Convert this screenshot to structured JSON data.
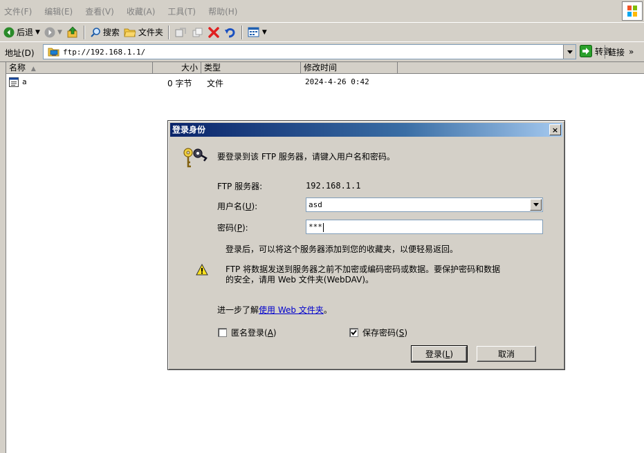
{
  "menu": {
    "items": [
      "文件(F)",
      "编辑(E)",
      "查看(V)",
      "收藏(A)",
      "工具(T)",
      "帮助(H)"
    ]
  },
  "toolbar": {
    "back_label": "后退",
    "search_label": "搜索",
    "folders_label": "文件夹"
  },
  "address": {
    "label": "地址(D)",
    "value": "ftp://192.168.1.1/",
    "go_label": "转到",
    "links_label": "链接",
    "links_chevron": "»"
  },
  "list": {
    "columns": {
      "name": "名称",
      "size": "大小",
      "type": "类型",
      "modified": "修改时间"
    },
    "rows": [
      {
        "name": "a",
        "size": "0 字节",
        "type": "文件",
        "modified": "2024-4-26 0:42"
      }
    ]
  },
  "dialog": {
    "title": "登录身份",
    "close": "×",
    "prompt": "要登录到该 FTP 服务器，请键入用户名和密码。",
    "server_label": "FTP 服务器:",
    "server_value": "192.168.1.1",
    "username_label_pre": "用户名(",
    "username_label_key": "U",
    "username_label_post": "):",
    "username_value": "asd",
    "password_label_pre": "密码(",
    "password_label_key": "P",
    "password_label_post": "):",
    "password_value": "***",
    "favorites_note": "登录后，可以将这个服务器添加到您的收藏夹，以便轻易返回。",
    "warning_line1": "FTP 将数据发送到服务器之前不加密或编码密码或数据。要保护密码和数据",
    "warning_line2": "的安全，请用 Web 文件夹(WebDAV)。",
    "learn_more_prefix": "进一步了解",
    "learn_more_link": "使用 Web 文件夹",
    "learn_more_suffix": "。",
    "anonymous_label_pre": "匿名登录(",
    "anonymous_label_key": "A",
    "anonymous_label_post": ")",
    "anonymous_checked": false,
    "save_password_label_pre": "保存密码(",
    "save_password_label_key": "S",
    "save_password_label_post": ")",
    "save_password_checked": true,
    "login_button_pre": "登录(",
    "login_button_key": "L",
    "login_button_post": ")",
    "cancel_button": "取消"
  },
  "colors": {
    "titlebar_start": "#0a246a",
    "titlebar_end": "#a6caf0",
    "link": "#0000cc",
    "window_bg": "#d4d0c8"
  }
}
